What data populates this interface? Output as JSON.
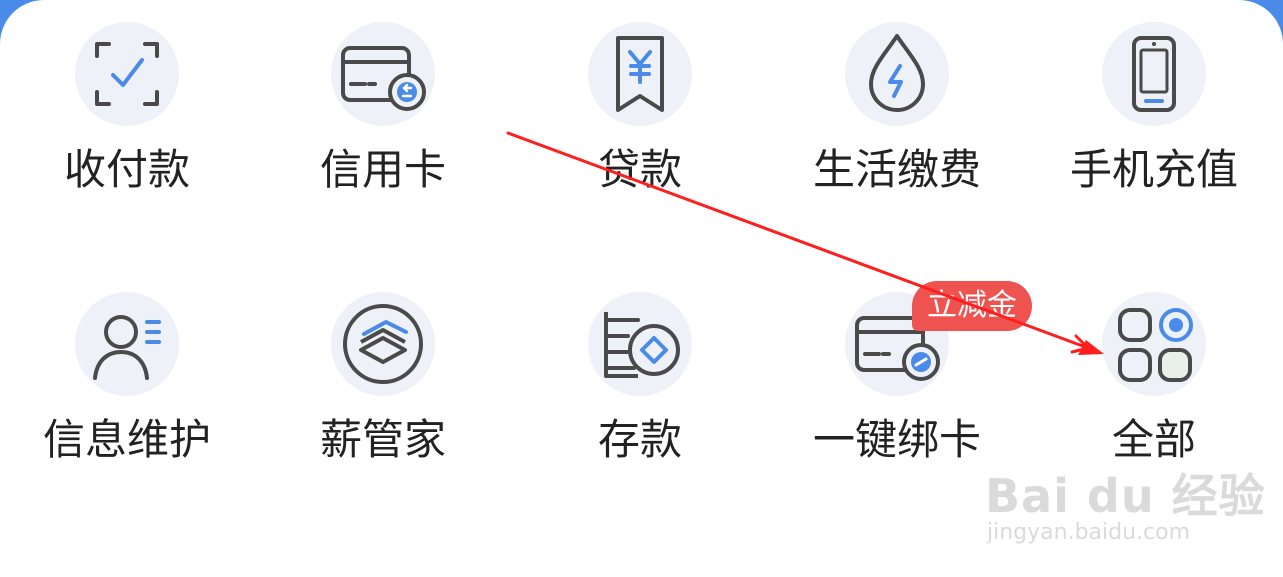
{
  "colors": {
    "accent_blue": "#4a8ae8",
    "icon_stroke": "#4a4a4a",
    "icon_circle_bg": "#eef1f8",
    "badge_red": "#ef5350",
    "annotation_arrow": "#ff1e1e",
    "label_text": "#222222"
  },
  "row1": [
    {
      "label": "收付款",
      "icon": "scan-pay-icon"
    },
    {
      "label": "信用卡",
      "icon": "credit-card-icon"
    },
    {
      "label": "贷款",
      "icon": "loan-yen-icon"
    },
    {
      "label": "生活缴费",
      "icon": "utility-drop-icon"
    },
    {
      "label": "手机充值",
      "icon": "phone-topup-icon"
    }
  ],
  "row2": [
    {
      "label": "信息维护",
      "icon": "user-info-icon"
    },
    {
      "label": "薪管家",
      "icon": "salary-stack-icon"
    },
    {
      "label": "存款",
      "icon": "deposit-coins-icon"
    },
    {
      "label": "一键绑卡",
      "icon": "bind-card-icon"
    },
    {
      "label": "全部",
      "icon": "all-grid-icon"
    }
  ],
  "badge": {
    "text": "立减金"
  },
  "watermark": {
    "logo_text": "Bai du 经验",
    "url_text": "jingyan.baidu.com"
  }
}
